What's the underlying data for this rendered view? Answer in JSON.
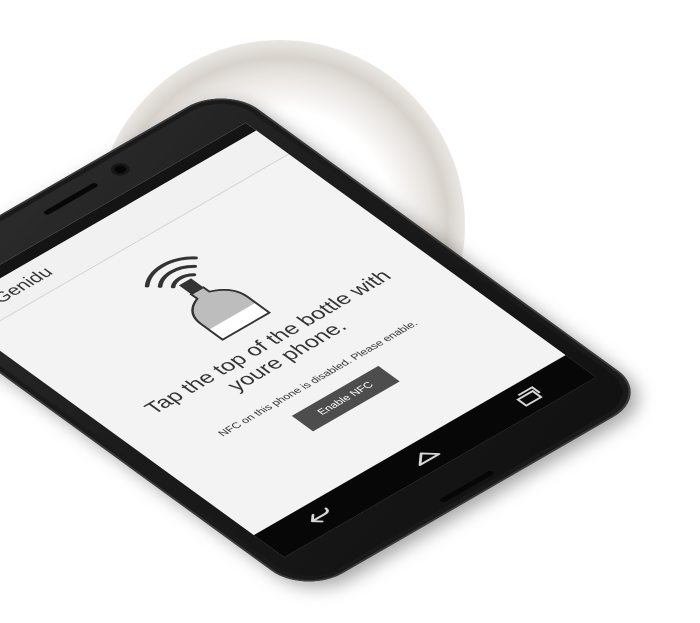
{
  "app": {
    "title": "Genidu",
    "logo_letter": "G"
  },
  "main": {
    "instruction": "Tap the top of the bottle with youre phone.",
    "nfc_message": "NFC on this phone is disabled. Please enable.",
    "enable_button_label": "Enable NFC"
  },
  "icons": {
    "nfc": "nfc-signal-icon",
    "bottle": "wine-bottle-icon",
    "back": "back-icon",
    "home": "home-icon",
    "recents": "recent-apps-icon"
  },
  "colors": {
    "screen_bg": "#f3f3f3",
    "button_bg": "#4d4d4d",
    "device_body": "#1b1b1b"
  }
}
